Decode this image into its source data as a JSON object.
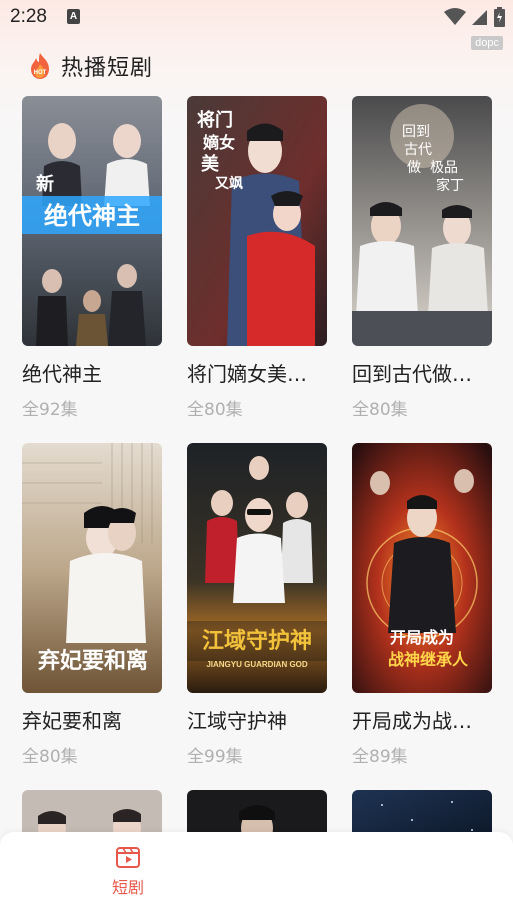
{
  "status_bar": {
    "time": "2:28",
    "indicator": "A",
    "icons": [
      "wifi-icon",
      "signal-icon",
      "battery-icon"
    ]
  },
  "dev_badge": "dopc",
  "section": {
    "icon": "hot-flame-icon",
    "icon_text": "HOT",
    "title": "热播短剧"
  },
  "dramas": [
    {
      "title": "绝代神主",
      "episodes": "全92集",
      "poster_text": "绝代神主",
      "poster_label": "新"
    },
    {
      "title": "将门嫡女美…",
      "episodes": "全80集",
      "poster_text": "将门嫡女美又飒"
    },
    {
      "title": "回到古代做…",
      "episodes": "全80集",
      "poster_text": "回到古代做极品家丁"
    },
    {
      "title": "弃妃要和离",
      "episodes": "全80集",
      "poster_text": "弃妃要和离"
    },
    {
      "title": "江域守护神",
      "episodes": "全99集",
      "poster_text": "江域守护神",
      "poster_subtext": "JIANGYU GUARDIAN GOD"
    },
    {
      "title": "开局成为战…",
      "episodes": "全89集",
      "poster_text": "开局成为战神继承人"
    }
  ],
  "bottom_nav": {
    "items": [
      {
        "label": "短剧",
        "icon": "short-drama-icon",
        "active": true
      }
    ]
  },
  "colors": {
    "accent": "#e8584a",
    "muted_text": "#b0b0b0",
    "title_text": "#222222"
  }
}
